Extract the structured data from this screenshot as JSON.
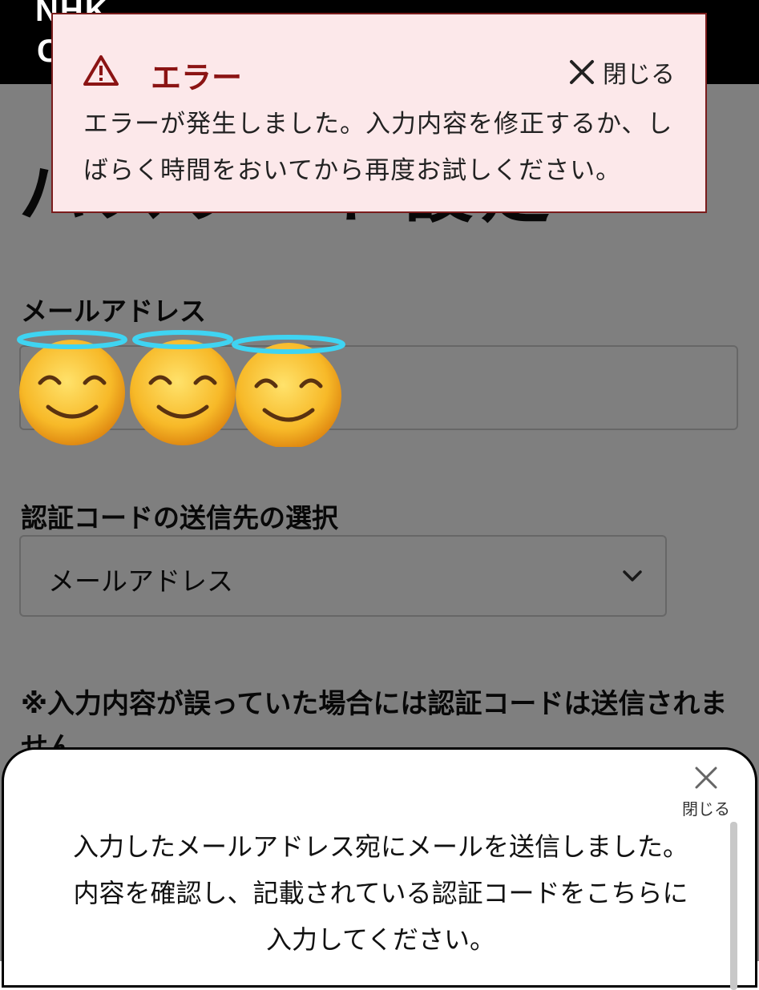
{
  "header": {
    "logo_text": "NHK",
    "logo_sub": "C"
  },
  "page": {
    "title": "パスワード設定"
  },
  "form": {
    "email_label": "メールアドレス",
    "method_label": "認証コードの送信先の選択",
    "method_value": "メールアドレス",
    "note": "※入力内容が誤っていた場合には認証コードは送信されません"
  },
  "error_dialog": {
    "title": "エラー",
    "close_label": "閉じる",
    "message": "エラーが発生しました。入力内容を修正するか、しばらく時間をおいてから再度お試しください。"
  },
  "bottom_sheet": {
    "close_label": "閉じる",
    "message_line1": "入力したメールアドレス宛にメールを送信しました。",
    "message_line2": "内容を確認し、記載されている認証コードをこちらに",
    "message_line3": "入力してください。"
  },
  "icons": {
    "warning": "warning-triangle-icon",
    "close": "close-x-icon",
    "dropdown": "chevron-down-icon",
    "sticker": "smiling-face-with-halo-emoji"
  },
  "colors": {
    "error_bg": "#fce8ea",
    "error_title": "#8b1414",
    "error_border": "#7a1c1c",
    "header_bg": "#000000",
    "overlay": "rgba(0,0,0,0.5)"
  }
}
